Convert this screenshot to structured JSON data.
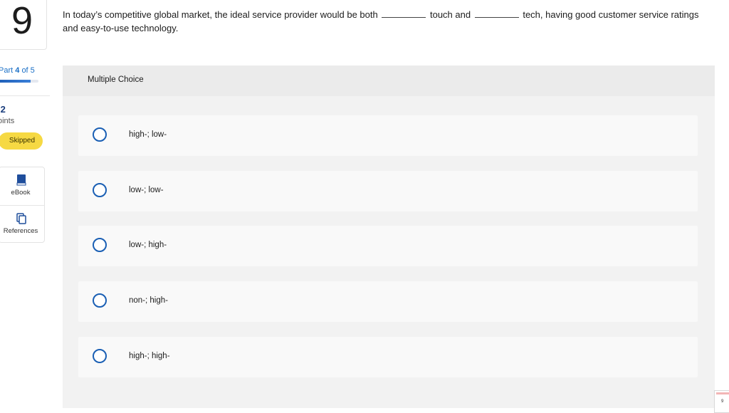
{
  "question": {
    "number": "9",
    "text_part1": "In today’s competitive global market, the ideal service provider would be both",
    "text_part2": "touch and",
    "text_part3": "tech, having good customer service ratings and easy-to-use technology."
  },
  "sidebar": {
    "part_prefix": "Part",
    "part_current": "4",
    "part_of": "of 5",
    "progress_fraction": 0.8,
    "points_value": ".2",
    "points_label": "oints",
    "status_badge": "Skipped",
    "tools": [
      {
        "label": "eBook",
        "icon": "book-icon"
      },
      {
        "label": "References",
        "icon": "copy-icon"
      }
    ]
  },
  "answer_panel": {
    "title": "Multiple Choice",
    "options": [
      {
        "label": "high-; low-"
      },
      {
        "label": "low-; low-"
      },
      {
        "label": "low-; high-"
      },
      {
        "label": "non-; high-"
      },
      {
        "label": "high-; high-"
      }
    ]
  },
  "thumbnail": {
    "number": "9"
  },
  "colors": {
    "accent": "#1a5fb4",
    "badge": "#f6d943",
    "panel_bg": "#f2f2f2"
  }
}
